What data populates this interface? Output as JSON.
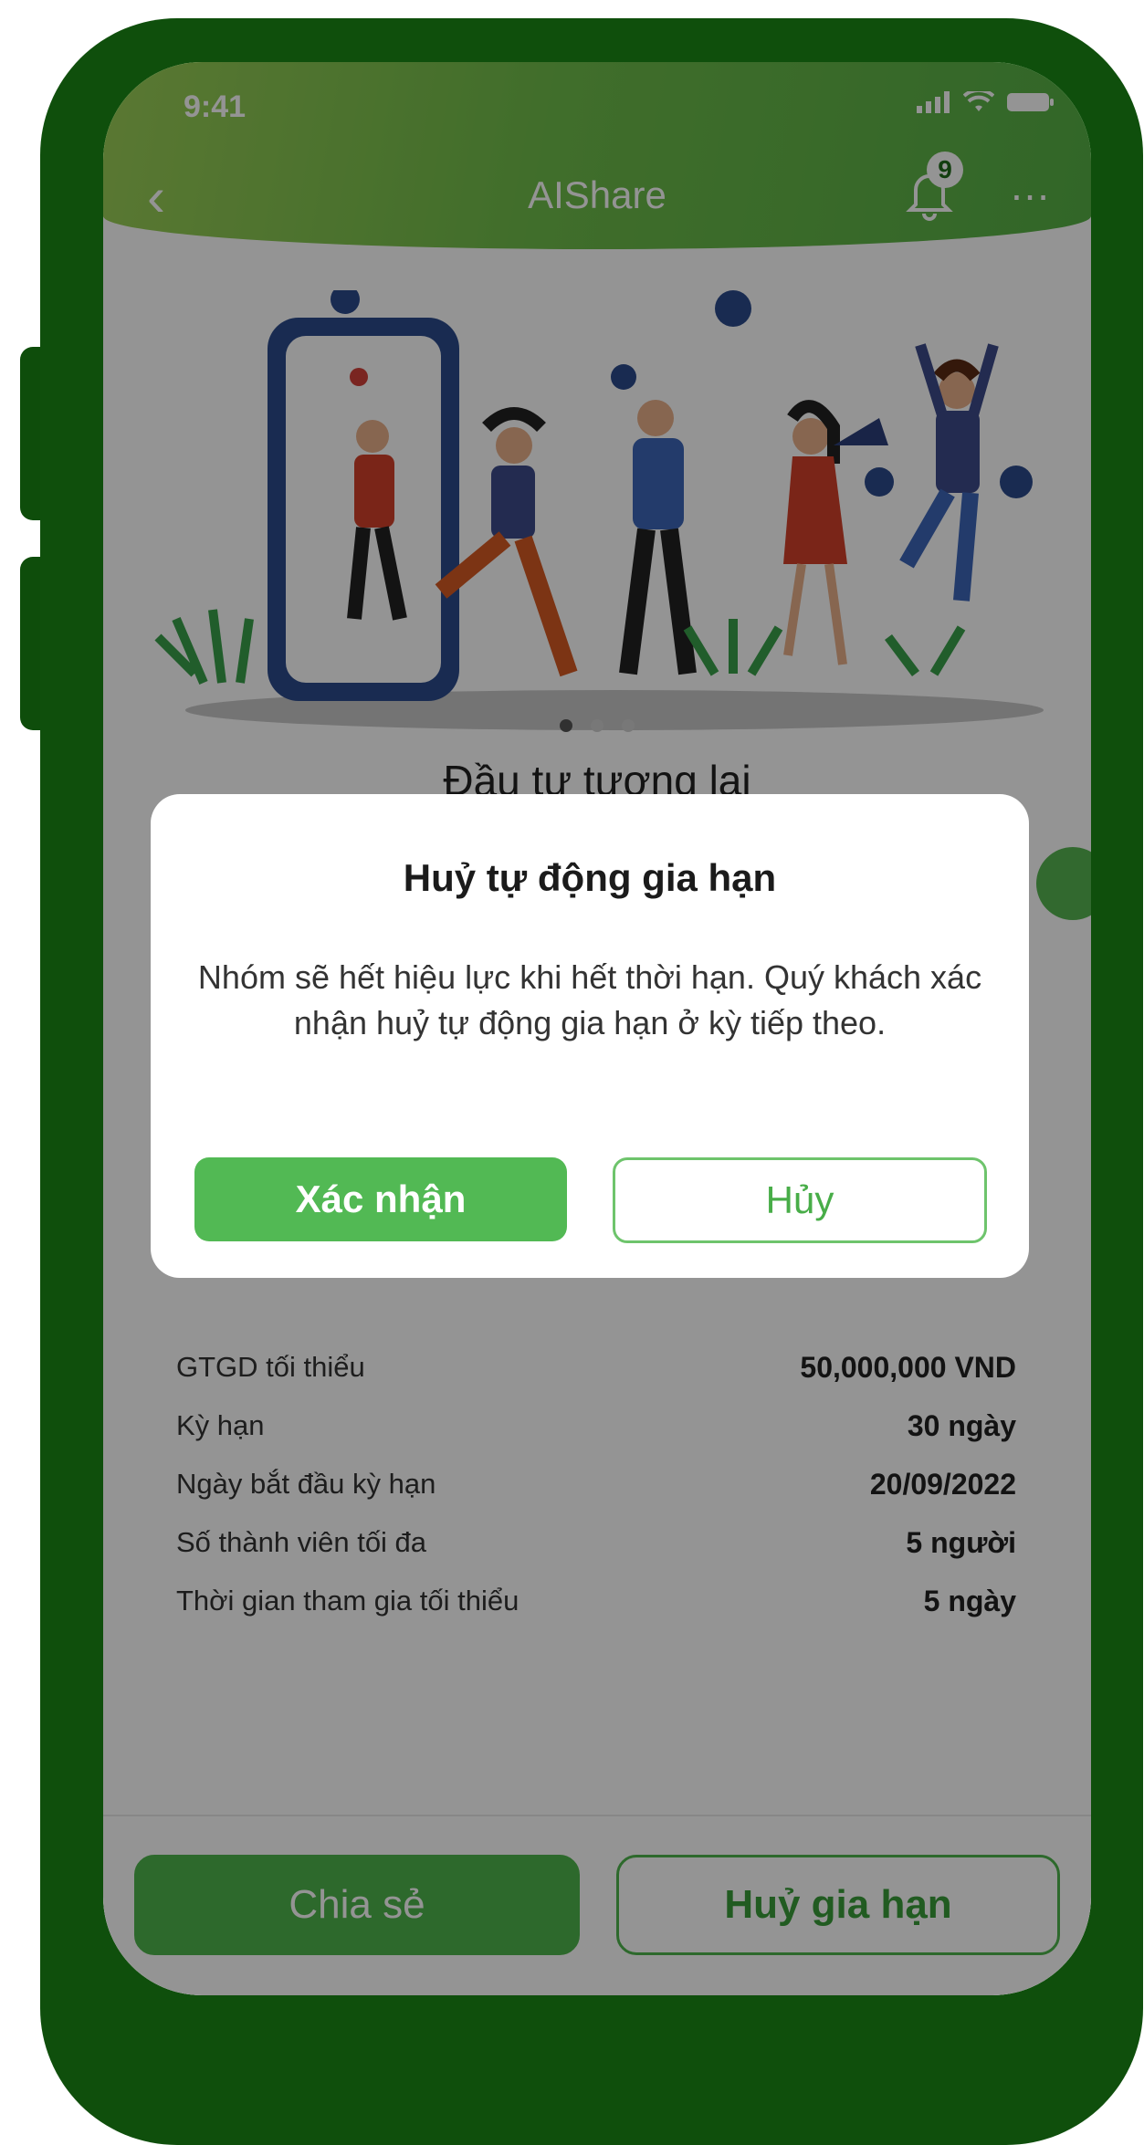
{
  "status_bar": {
    "time": "9:41"
  },
  "header": {
    "title": "AIShare",
    "notification_count": "9"
  },
  "carousel": {
    "subtitle": "Đầu tư tương lai",
    "page_count": 3,
    "active_page": 1
  },
  "group_info": {
    "rows": [
      {
        "label": "GTGD tối thiểu",
        "value": "50,000,000 VND"
      },
      {
        "label": "Kỳ hạn",
        "value": "30 ngày"
      },
      {
        "label": "Ngày bắt đầu kỳ hạn",
        "value": "20/09/2022"
      },
      {
        "label": "Số thành viên tối đa",
        "value": "5 người"
      },
      {
        "label": "Thời gian tham gia tối thiểu",
        "value": "5 ngày"
      }
    ]
  },
  "footer": {
    "share_label": "Chia sẻ",
    "cancel_renew_label": "Huỷ gia hạn"
  },
  "dialog": {
    "title": "Huỷ tự động gia hạn",
    "message": "Nhóm sẽ hết hiệu lực khi hết thời hạn. Quý khách xác nhận huỷ tự động gia hạn ở kỳ tiếp theo.",
    "confirm_label": "Xác nhận",
    "cancel_label": "Hủy"
  },
  "colors": {
    "frame": "#0f4f0c",
    "accent": "#52b954",
    "header_gradient_start": "#9ccf57"
  }
}
